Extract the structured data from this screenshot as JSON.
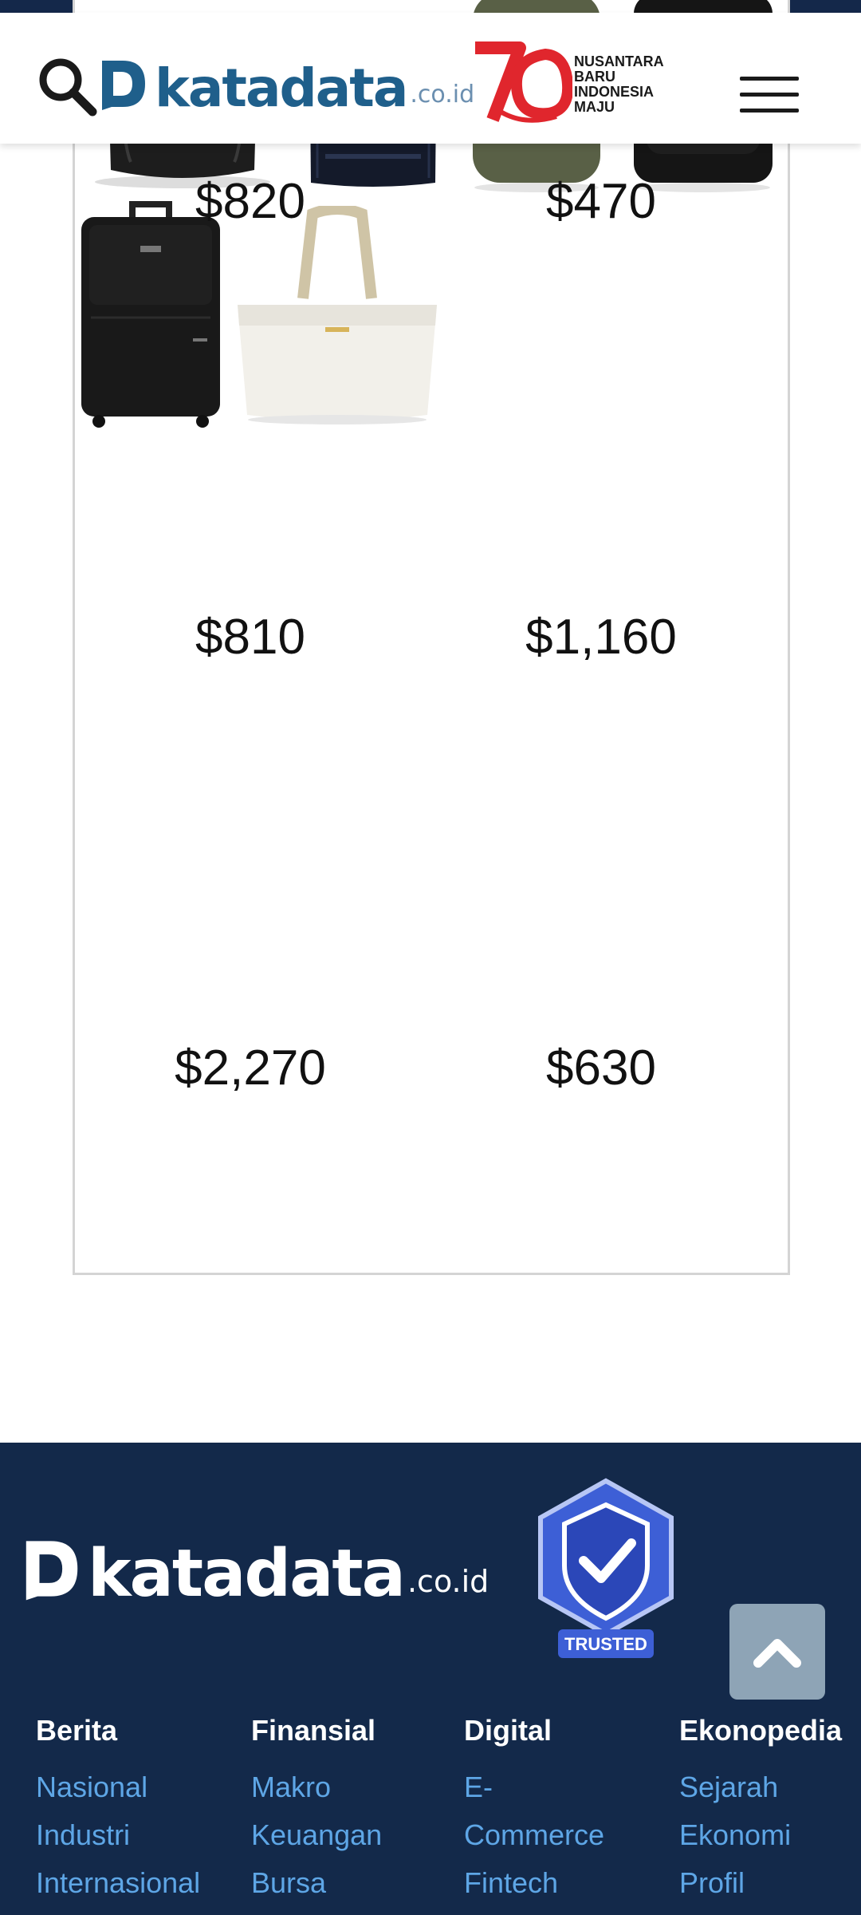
{
  "header": {
    "logo_text": "katadata",
    "logo_tld": ".co.id",
    "anniversary_text": [
      "NUSANTARA",
      "BARU",
      "INDONESIA",
      "MAJU"
    ]
  },
  "products": [
    {
      "price": "$820",
      "icon": "backpack-icon"
    },
    {
      "price": "$470",
      "icon": "backpack-icon"
    },
    {
      "price": "$810",
      "icon": "olive-backpack-icon"
    },
    {
      "price": "$1,160",
      "icon": "black-backpack-icon"
    },
    {
      "price": "$2,270",
      "icon": "suitcase-icon"
    },
    {
      "price": "$630",
      "icon": "tote-bag-icon"
    }
  ],
  "footer": {
    "logo_text": "katadata",
    "logo_tld": ".co.id",
    "badge_text": "TRUSTED",
    "columns": [
      {
        "title": "Berita",
        "links": [
          "Nasional",
          "Industri",
          "Internasional"
        ]
      },
      {
        "title": "Finansial",
        "links": [
          "Makro",
          "Keuangan",
          "Bursa"
        ]
      },
      {
        "title": "Digital",
        "links": [
          "E-",
          "Commerce",
          "Fintech"
        ]
      },
      {
        "title": "Ekonopedia",
        "links": [
          "Sejarah",
          "Ekonomi",
          "Profil"
        ]
      }
    ]
  },
  "colors": {
    "navy": "#13294a",
    "brand_blue": "#1f5f8b",
    "link_blue": "#5ea6e6",
    "anniversary_red": "#e0262d"
  }
}
